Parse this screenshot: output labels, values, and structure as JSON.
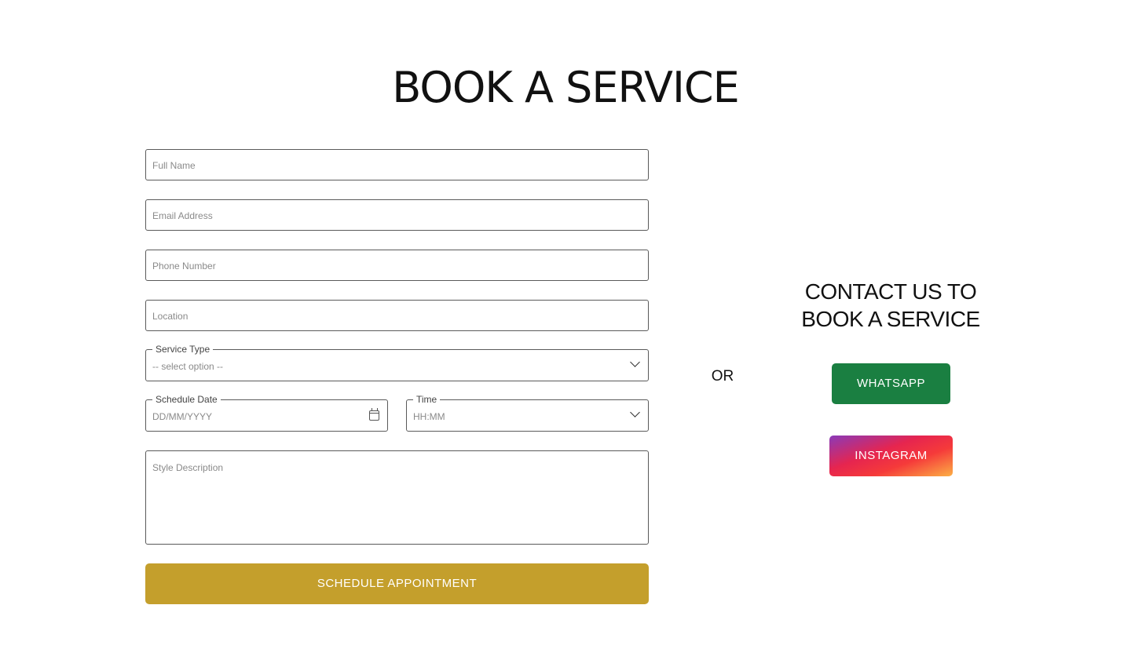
{
  "page": {
    "title": "BOOK A SERVICE"
  },
  "form": {
    "full_name": {
      "placeholder": "Full Name",
      "value": ""
    },
    "email": {
      "placeholder": "Email Address",
      "value": ""
    },
    "phone": {
      "placeholder": "Phone Number",
      "value": ""
    },
    "location": {
      "placeholder": "Location",
      "value": ""
    },
    "service_type": {
      "label": "Service Type",
      "selected": "-- select option --"
    },
    "schedule_date": {
      "label": "Schedule Date",
      "placeholder": "DD/MM/YYYY"
    },
    "time": {
      "label": "Time",
      "selected": "HH:MM"
    },
    "style_description": {
      "placeholder": "Style Description",
      "value": ""
    },
    "submit_label": "SCHEDULE APPOINTMENT"
  },
  "divider": {
    "or_label": "OR"
  },
  "contact": {
    "heading_line1": "CONTACT US TO",
    "heading_line2": "BOOK A SERVICE",
    "whatsapp_label": "WHATSAPP",
    "instagram_label": "INSTAGRAM"
  },
  "colors": {
    "submit_button": "#c49f2c",
    "whatsapp_button": "#1a7f41",
    "instagram_gradient": [
      "#8a3ab9",
      "#e6254f",
      "#fcaf45"
    ]
  },
  "icons": {
    "service_type_dropdown": "chevron-down-icon",
    "time_dropdown": "chevron-down-icon",
    "date_picker": "calendar-icon"
  }
}
